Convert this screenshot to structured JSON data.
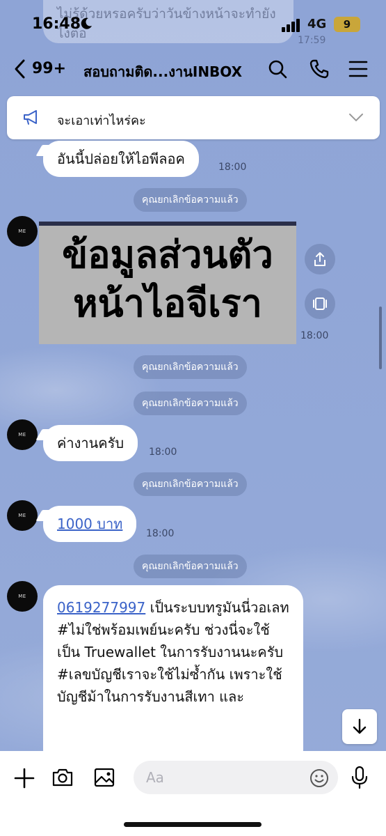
{
  "status_bar": {
    "time": "16:48",
    "network": "4G",
    "battery": "9",
    "ghost_text": "ไม่รู้ด้วยหรอครับว่าวันข้างหน้าจะทำยังไงต่อ",
    "ghost_time": "17:59"
  },
  "header": {
    "unread_count": "99+",
    "title": "สอบถามติด...งานINBOX"
  },
  "announcement": {
    "text": "จะเอาเท่าไหร่คะ"
  },
  "messages": {
    "m1": {
      "text": "อันนี้ปล่อยให้ไอพีลอค",
      "time": "18:00"
    },
    "sys1": "คุณยกเลิกข้อความแล้ว",
    "image": {
      "line1": "ข้อมูลส่วนตัว",
      "line2": "หน้าไอจีเรา",
      "time": "18:00"
    },
    "sys2": "คุณยกเลิกข้อความแล้ว",
    "sys3": "คุณยกเลิกข้อความแล้ว",
    "m2": {
      "text": "ค่างานครับ",
      "time": "18:00"
    },
    "sys4": "คุณยกเลิกข้อความแล้ว",
    "m3": {
      "text": "1000 บาท",
      "time": "18:00"
    },
    "sys5": "คุณยกเลิกข้อความแล้ว",
    "m4": {
      "phone": "0619277997",
      "line1_rest": " เป็นระบบทรูมันนี่วอเลท",
      "line2": "#ไม่ใช่พร้อมเพย์นะครับ ช่วงนี่จะใช้เป็น Truewallet ในการรับงานนะครับ",
      "line3": "#เลขบัญชีเราจะใช้ไม่ซ้ำกัน เพราะใช้บัญชีม้าในการรับงานสีเทา และ"
    },
    "avatar_label": "ME"
  },
  "input": {
    "placeholder": "Aa"
  },
  "colors": {
    "background": "#8fa6d8",
    "bubble": "#ffffff",
    "link": "#3b63c8",
    "system_pill": "#6e82af"
  }
}
